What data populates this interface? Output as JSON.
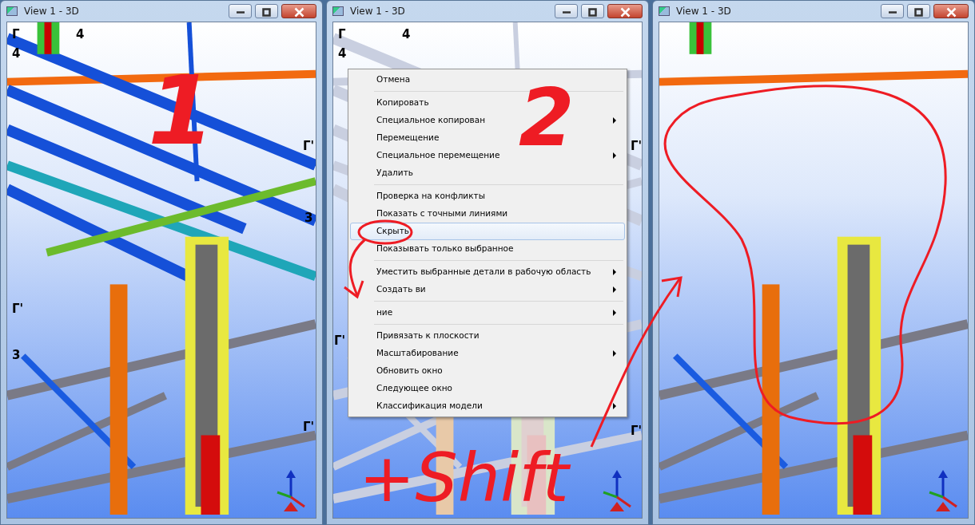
{
  "windows": [
    {
      "title": "View 1 - 3D",
      "kind": "normal",
      "grid_labels": [
        "Г",
        "4",
        "4",
        "Г'",
        "3",
        "Г'",
        "3",
        "Г'"
      ],
      "annotations": [
        {
          "kind": "number",
          "text": "1"
        }
      ]
    },
    {
      "title": "View 1 - 3D",
      "kind": "selected",
      "grid_labels": [
        "Г",
        "4",
        "4",
        "Г'",
        "Г'",
        "Г'"
      ],
      "annotations": [
        {
          "kind": "number",
          "text": "2"
        },
        {
          "kind": "note",
          "text": "+Shift"
        },
        {
          "kind": "circle"
        },
        {
          "kind": "arrow"
        }
      ],
      "context_menu": [
        {
          "kind": "item",
          "label": "Отмена",
          "submenu": false,
          "selected": false
        },
        {
          "kind": "separator"
        },
        {
          "kind": "item",
          "label": "Копировать",
          "submenu": false,
          "selected": false
        },
        {
          "kind": "item",
          "label": "Специальное копирован",
          "submenu": true,
          "selected": false
        },
        {
          "kind": "item",
          "label": "Перемещение",
          "submenu": false,
          "selected": false
        },
        {
          "kind": "item",
          "label": "Специальное перемещение",
          "submenu": true,
          "selected": false
        },
        {
          "kind": "item",
          "label": "Удалить",
          "submenu": false,
          "selected": false
        },
        {
          "kind": "separator"
        },
        {
          "kind": "item",
          "label": "Проверка на конфликты",
          "submenu": false,
          "selected": false
        },
        {
          "kind": "item",
          "label": "Показать с точными линиями",
          "submenu": false,
          "selected": false
        },
        {
          "kind": "item",
          "label": "Скрыть",
          "submenu": false,
          "selected": true
        },
        {
          "kind": "item",
          "label": "Показывать только выбранное",
          "submenu": false,
          "selected": false
        },
        {
          "kind": "separator"
        },
        {
          "kind": "item",
          "label": "Уместить выбранные детали в рабочую область",
          "submenu": true,
          "selected": false
        },
        {
          "kind": "item",
          "label": "Создать ви",
          "submenu": true,
          "selected": false
        },
        {
          "kind": "separator"
        },
        {
          "kind": "item",
          "label": "ние",
          "submenu": true,
          "selected": false
        },
        {
          "kind": "separator"
        },
        {
          "kind": "item",
          "label": "Привязать к плоскости",
          "submenu": false,
          "selected": false
        },
        {
          "kind": "item",
          "label": "Масштабирование",
          "submenu": true,
          "selected": false
        },
        {
          "kind": "item",
          "label": "Обновить окно",
          "submenu": false,
          "selected": false
        },
        {
          "kind": "item",
          "label": "Следующее окно",
          "submenu": false,
          "selected": false
        },
        {
          "kind": "item",
          "label": "Классификация модели",
          "submenu": true,
          "selected": false
        }
      ]
    },
    {
      "title": "View 1 - 3D",
      "kind": "hidden",
      "annotations": [
        {
          "kind": "loop"
        },
        {
          "kind": "arrow"
        }
      ]
    }
  ]
}
